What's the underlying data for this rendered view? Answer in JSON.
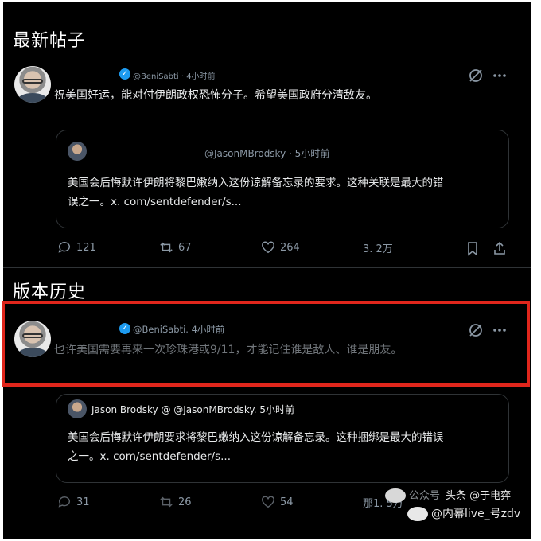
{
  "sections": {
    "latest_title": "最新帖子",
    "history_title": "版本历史"
  },
  "latest_post": {
    "handle_time": "@BeniSabti · 4小时前",
    "text": "祝美国好运，能对付伊朗政权恐怖分子。希望美国政府分清敌友。",
    "quote": {
      "handle_time": "@JasonMBrodsky  ·  5小时前",
      "line1": "美国会后悔默许伊朗将黎巴嫩纳入这份谅解备忘录的要求。这种关联是最大的错",
      "line2": "误之一。x. com/sentdefender/s..."
    },
    "actions": {
      "replies": "121",
      "reposts": "67",
      "likes": "264",
      "views": "3. 2万"
    }
  },
  "history_post": {
    "handle_time": "@BeniSabti. 4小时前",
    "text": "也许美国需要再来一次珍珠港或9/11，才能记住谁是敌人、谁是朋友。",
    "quote": {
      "author": "Jason Brodsky @ @JasonMBrodsky. 5小时前",
      "line1": "美国会后悔默许伊朗要求将黎巴嫩纳入这份谅解备忘录。这种捆绑是最大的错误",
      "line2": "之一。x. com/sentdefender/s..."
    },
    "actions": {
      "replies": "31",
      "reposts": "26",
      "likes": "54",
      "views": "那1. 5万"
    }
  },
  "watermark": {
    "line1": "公众号",
    "line2": "头条 @于电弈",
    "line3": "@内幕live_号zdv"
  },
  "icons": [
    "verified-badge-icon",
    "grok-icon",
    "more-icon",
    "reply-icon",
    "repost-icon",
    "like-icon",
    "views-icon",
    "bookmark-icon",
    "share-icon"
  ],
  "colors": {
    "highlight": "#e0261c",
    "verified": "#1d9bf0",
    "background": "#000000"
  }
}
